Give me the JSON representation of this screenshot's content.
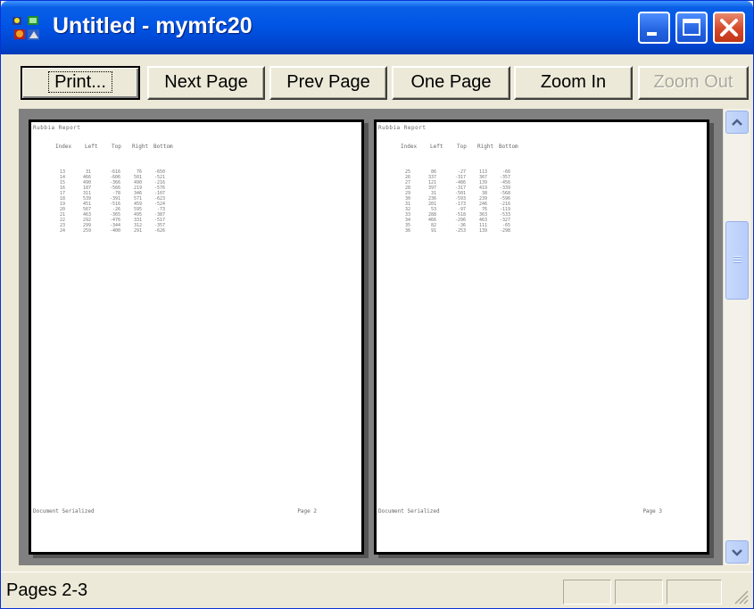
{
  "window": {
    "title": "Untitled - mymfc20",
    "icon": "mfc-app-icon",
    "controls": [
      "minimize-icon",
      "maximize-icon",
      "close-icon"
    ]
  },
  "toolbar": {
    "print_label": "Print...",
    "next_page_label": "Next Page",
    "prev_page_label": "Prev Page",
    "one_page_label": "One Page",
    "zoom_in_label": "Zoom In",
    "zoom_out_label": "Zoom Out"
  },
  "pages": [
    {
      "header": "Rubbia Report",
      "columns": [
        "Index",
        "Left",
        "Top",
        "Right",
        "Bottom"
      ],
      "rows": [
        [
          "13",
          "31",
          "-616",
          "76",
          "-650"
        ],
        [
          "14",
          "466",
          "-606",
          "501",
          "-521"
        ],
        [
          "15",
          "490",
          "-366",
          "490",
          "-216"
        ],
        [
          "16",
          "187",
          "-566",
          "219",
          "-576"
        ],
        [
          "17",
          "311",
          "-78",
          "346",
          "-107"
        ],
        [
          "18",
          "539",
          "-391",
          "571",
          "-623"
        ],
        [
          "19",
          "451",
          "-516",
          "459",
          "-524"
        ],
        [
          "20",
          "567",
          "-26",
          "595",
          "-73"
        ],
        [
          "21",
          "463",
          "-365",
          "495",
          "-387"
        ],
        [
          "22",
          "292",
          "-476",
          "331",
          "-517"
        ],
        [
          "23",
          "299",
          "-344",
          "312",
          "-357"
        ],
        [
          "24",
          "259",
          "-400",
          "291",
          "-626"
        ]
      ],
      "footer": "Document Serialized",
      "page_number": "Page 2"
    },
    {
      "header": "Rubbia Report",
      "columns": [
        "Index",
        "Left",
        "Top",
        "Right",
        "Bottom"
      ],
      "rows": [
        [
          "25",
          "86",
          "-27",
          "113",
          "-66"
        ],
        [
          "26",
          "337",
          "-317",
          "367",
          "-357"
        ],
        [
          "27",
          "121",
          "-486",
          "139",
          "-456"
        ],
        [
          "28",
          "397",
          "-317",
          "419",
          "-339"
        ],
        [
          "29",
          "31",
          "-501",
          "38",
          "-568"
        ],
        [
          "30",
          "236",
          "-593",
          "239",
          "-596"
        ],
        [
          "31",
          "201",
          "-173",
          "246",
          "-216"
        ],
        [
          "32",
          "53",
          "-97",
          "76",
          "-119"
        ],
        [
          "33",
          "288",
          "-518",
          "363",
          "-533"
        ],
        [
          "34",
          "466",
          "-296",
          "463",
          "-327"
        ],
        [
          "35",
          "82",
          "-36",
          "111",
          "-65"
        ],
        [
          "36",
          "91",
          "-253",
          "139",
          "-298"
        ]
      ],
      "footer": "Document Serialized",
      "page_number": "Page 3"
    }
  ],
  "statusbar": {
    "text": "Pages 2-3"
  }
}
